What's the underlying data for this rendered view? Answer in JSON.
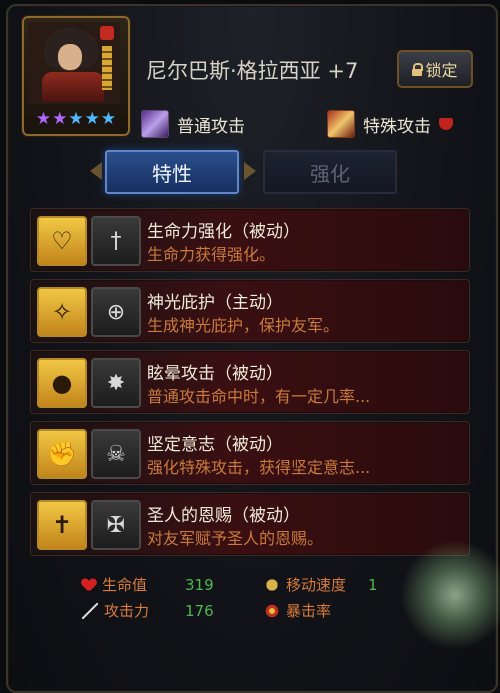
{
  "hero": {
    "name": "尼尔巴斯·格拉西亚 +7",
    "stars": [
      "★",
      "★",
      "★",
      "★",
      "★"
    ],
    "star_colors": [
      "#b066ff",
      "#b066ff",
      "#4fb8ff",
      "#4fb8ff",
      "#4fb8ff"
    ],
    "lock_label": "锁定"
  },
  "attacks": {
    "normal_label": "普通攻击",
    "special_label": "特殊攻击"
  },
  "tabs": {
    "traits": "特性",
    "enhance": "强化"
  },
  "skills": [
    {
      "title": "生命力强化（被动）",
      "desc": "生命力获得强化。",
      "icon": "heart-shield-icon",
      "rank_icon": "sword-icon"
    },
    {
      "title": "神光庇护（主动）",
      "desc": "生成神光庇护，保护友军。",
      "icon": "holy-light-icon",
      "rank_icon": "target-icon"
    },
    {
      "title": "眩晕攻击（被动）",
      "desc": "普通攻击命中时，有一定几率...",
      "icon": "stun-icon",
      "rank_icon": "burst-icon"
    },
    {
      "title": "坚定意志（被动）",
      "desc": "强化特殊攻击，获得坚定意志...",
      "icon": "fist-icon",
      "rank_icon": "skull-icon"
    },
    {
      "title": "圣人的恩赐（被动）",
      "desc": "对友军赋予圣人的恩赐。",
      "icon": "cross-icon",
      "rank_icon": "winged-emblem-icon"
    }
  ],
  "stats": {
    "hp_label": "生命值",
    "hp_value": "319",
    "atk_label": "攻击力",
    "atk_value": "176",
    "move_label": "移动速度",
    "move_value": "1",
    "crit_label": "暴击率"
  }
}
